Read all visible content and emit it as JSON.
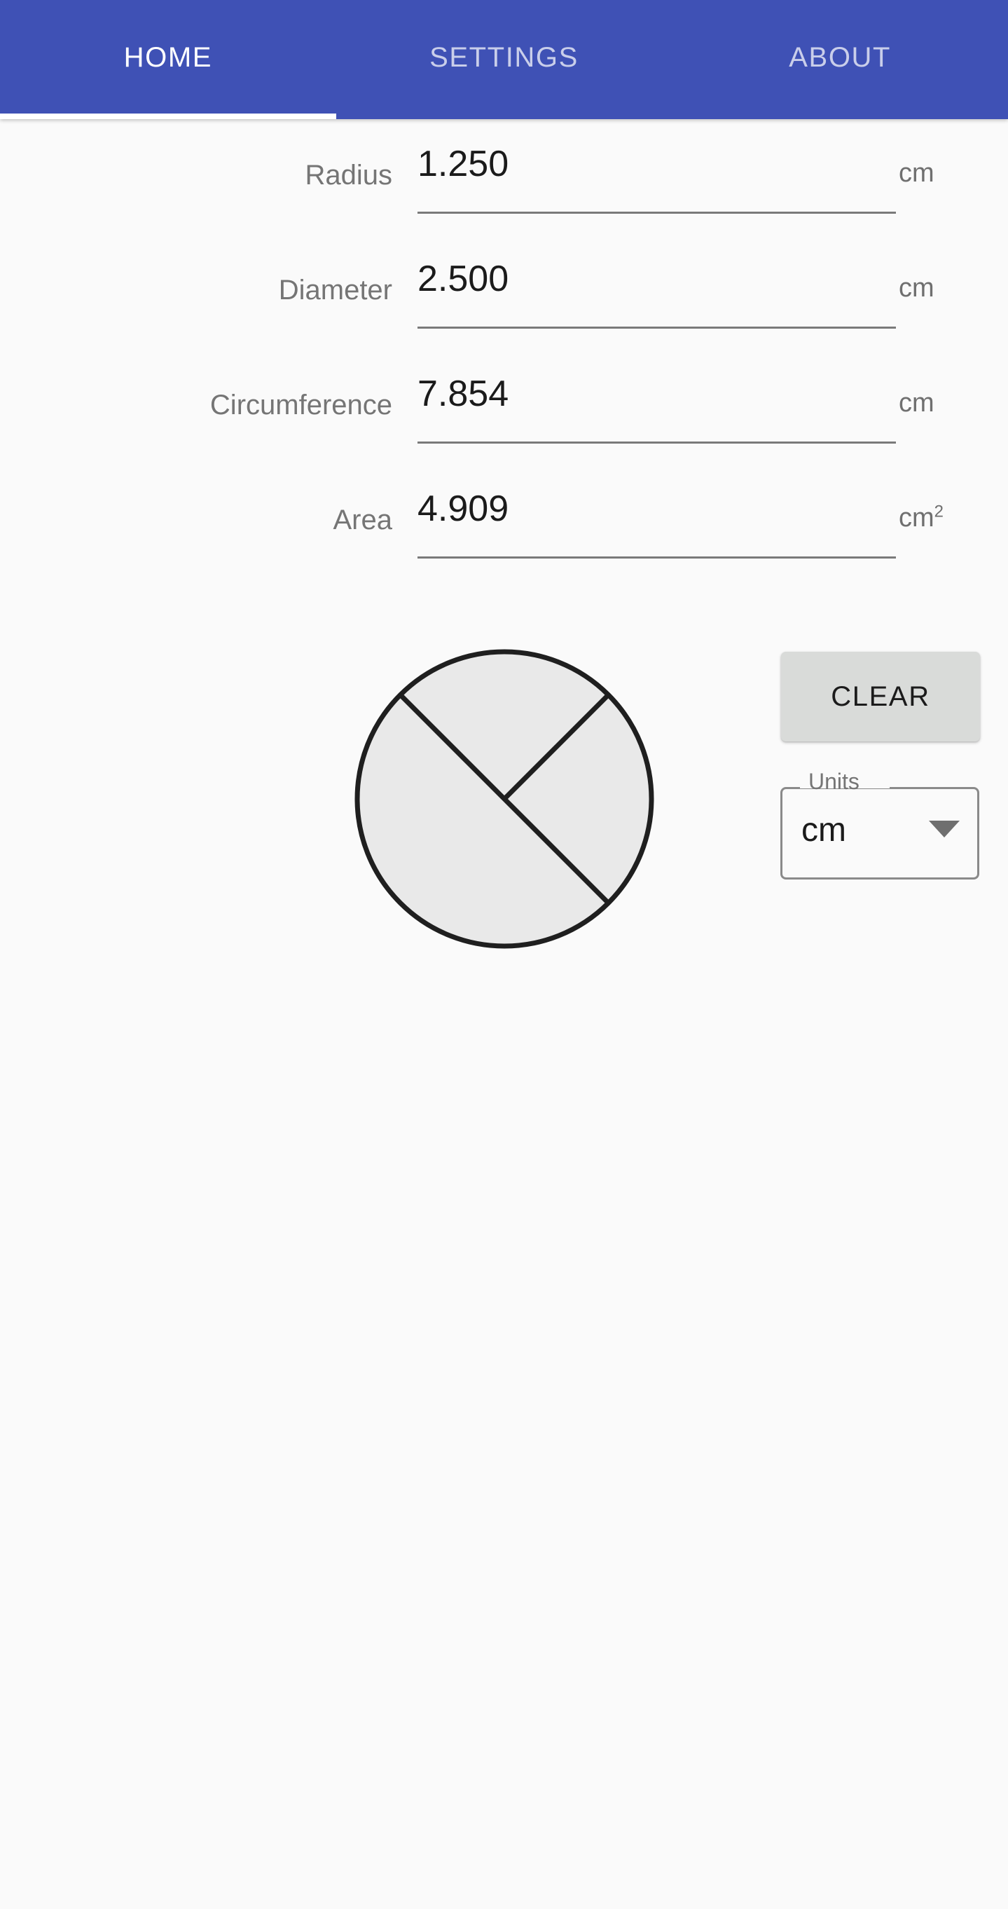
{
  "tabs": [
    {
      "label": "HOME",
      "active": true
    },
    {
      "label": "SETTINGS",
      "active": false
    },
    {
      "label": "ABOUT",
      "active": false
    }
  ],
  "fields": [
    {
      "label": "Radius",
      "value": "1.250",
      "unit": "cm",
      "unit_sup": "",
      "placeholder": ""
    },
    {
      "label": "Diameter",
      "value": "2.500",
      "unit": "cm",
      "unit_sup": "",
      "placeholder": ""
    },
    {
      "label": "Circumference",
      "value": "7.854",
      "unit": "cm",
      "unit_sup": "",
      "placeholder": ""
    },
    {
      "label": "Area",
      "value": "4.909",
      "unit": "cm",
      "unit_sup": "2",
      "placeholder": ""
    }
  ],
  "diagram": {
    "name": "circle-diagram",
    "fill": "#e9e9e9",
    "stroke": "#1f1f1f"
  },
  "controls": {
    "clear_label": "CLEAR",
    "units_label": "Units",
    "units_value": "cm",
    "units_options": [
      "cm"
    ]
  },
  "colors": {
    "tabbar": "#3f51b5",
    "background": "#fafafa",
    "underline": "#7a7a7a",
    "label_text": "#757575",
    "value_text": "#1b1b1b",
    "button_face": "#d9dbd9"
  }
}
